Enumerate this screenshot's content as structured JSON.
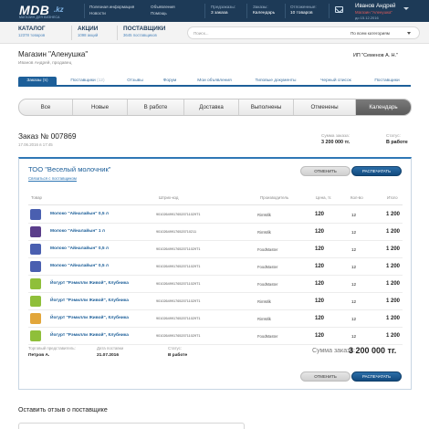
{
  "brand": {
    "logo": "MDB",
    "tld": ".kz",
    "tagline": "МАГАЗИН ДЛЯ БИЗНЕСА"
  },
  "topnav": {
    "col1": [
      "Полезная информация",
      "Новости"
    ],
    "col2": [
      "Объявления",
      "Помощь"
    ],
    "orders": {
      "label": "Предзаказы:",
      "value": "3 заказа"
    },
    "calendar": {
      "label": "Заказы:",
      "value": "Календарь"
    },
    "delivery": {
      "label": "Отложенные:",
      "value": "10 товаров"
    }
  },
  "user": {
    "name": "Иванов Андрей",
    "shop": "Магазин \"Аленушка\"",
    "date": "до 15.12.2016"
  },
  "catalog": [
    {
      "title": "КАТАЛОГ",
      "sub": "12378 товаров"
    },
    {
      "title": "АКЦИИ",
      "sub": "1098 акций"
    },
    {
      "title": "ПОСТАВЩИКИ",
      "sub": "3645 поставщиков"
    }
  ],
  "search": {
    "placeholder": "Поиск...",
    "scope": "По всем категориям"
  },
  "shop": {
    "title": "Магазин \"Аленушка\"",
    "owner": "Иванов Андрей, продавец",
    "seller": "ИП \"Семенов А. Н.\""
  },
  "tabs": [
    {
      "label": "Заказы",
      "count": "(5)"
    },
    {
      "label": "Поставщики",
      "count": "(12)"
    },
    {
      "label": "Отзывы",
      "count": ""
    },
    {
      "label": "Форум",
      "count": ""
    },
    {
      "label": "Мои объявления",
      "count": ""
    },
    {
      "label": "Типовые документы",
      "count": ""
    },
    {
      "label": "Черный список",
      "count": ""
    },
    {
      "label": "Поставщики",
      "count": ""
    }
  ],
  "statuses": [
    "Все",
    "Новые",
    "В работе",
    "Доставка",
    "Выполнены",
    "Отменены",
    "Календарь"
  ],
  "order": {
    "number": "Заказ № 007869",
    "date": "17.06.2016 в 17:45",
    "sum_label": "Сумма заказа:",
    "sum_value": "3 200 000 тг.",
    "status_label": "Статус:",
    "status_value": "В работе"
  },
  "supplier": {
    "name": "ТОО \"Веселый молочник\"",
    "link": "Связаться с поставщиком"
  },
  "buttons": {
    "cancel": "ОТМЕНИТЬ",
    "print": "РАСПЕЧАТАТЬ"
  },
  "table": {
    "headers": [
      "Товар",
      "Штрих-код",
      "Производитель",
      "Цена, тг.",
      "Кол-во",
      "Итого"
    ],
    "rows": [
      {
        "name": "Молоко \"Айналайын\" 0,5 л",
        "code": "901026499176520711029T1",
        "maker": "RimMilk",
        "price": "120",
        "qty": "12",
        "total": "1 200",
        "color": "#4a5fb0"
      },
      {
        "name": "Молоко \"Айналайын\" 1 л",
        "code": "901026499176520710211",
        "maker": "RimMilk",
        "price": "120",
        "qty": "12",
        "total": "1 200",
        "color": "#5a3d8a"
      },
      {
        "name": "Молоко \"Айналайын\" 0,5 л",
        "code": "901026499176520711029T1",
        "maker": "FoodMaster",
        "price": "120",
        "qty": "12",
        "total": "1 200",
        "color": "#4a5fb0"
      },
      {
        "name": "Молоко \"Айналайын\" 0,5 л",
        "code": "901026499176520711029T1",
        "maker": "FoodMaster",
        "price": "120",
        "qty": "12",
        "total": "1 200",
        "color": "#4a5fb0"
      },
      {
        "name": "Йогурт \"Рэмилли Живой\", Клубника",
        "code": "901026499176520711029T1",
        "maker": "FoodMaster",
        "price": "120",
        "qty": "12",
        "total": "1 200",
        "color": "#8fbf3a"
      },
      {
        "name": "Йогурт \"Рэмилли Живой\", Клубника",
        "code": "901026499176520711029T1",
        "maker": "RimMilk",
        "price": "120",
        "qty": "12",
        "total": "1 200",
        "color": "#8fbf3a"
      },
      {
        "name": "Йогурт \"Рэмилли Живой\", Клубника",
        "code": "901026499176520711029T1",
        "maker": "RimMilk",
        "price": "120",
        "qty": "12",
        "total": "1 200",
        "color": "#e2a63a"
      },
      {
        "name": "Йогурт \"Рэмилли Живой\", Клубника",
        "code": "901026499176520711029T1",
        "maker": "FoodMaster",
        "price": "120",
        "qty": "12",
        "total": "1 200",
        "color": "#8fbf3a"
      }
    ]
  },
  "footer": {
    "rep_label": "Торговый представитель:",
    "rep_value": "Петров А.",
    "delivery_label": "Дата поставки",
    "delivery_value": "21.07.2016",
    "status_label": "Статус:",
    "status_value": "В работе",
    "total_label": "Сумма заказа:",
    "total_value": "3 200 000 тг."
  },
  "review": {
    "title": "Оставить отзыв о поставщике"
  }
}
